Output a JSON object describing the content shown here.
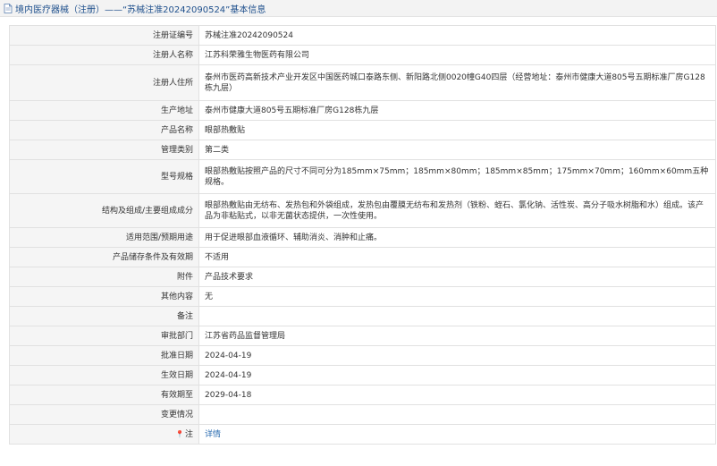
{
  "header": {
    "title": "境内医疗器械（注册）——“苏械注准20242090524”基本信息"
  },
  "rows": [
    {
      "label": "注册证编号",
      "value": "苏械注准20242090524"
    },
    {
      "label": "注册人名称",
      "value": "江苏科荣雅生物医药有限公司"
    },
    {
      "label": "注册人住所",
      "value": "泰州市医药高新技术产业开发区中国医药城口泰路东侧、新阳路北侧0020幢G40四层（经营地址：泰州市健康大道805号五期标准厂房G128栋九层）"
    },
    {
      "label": "生产地址",
      "value": "泰州市健康大道805号五期标准厂房G128栋九层"
    },
    {
      "label": "产品名称",
      "value": "眼部热敷贴"
    },
    {
      "label": "管理类别",
      "value": "第二类"
    },
    {
      "label": "型号规格",
      "value": "眼部热敷贴按照产品的尺寸不同可分为185mm×75mm；185mm×80mm；185mm×85mm；175mm×70mm；160mm×60mm五种规格。"
    },
    {
      "label": "结构及组成/主要组成成分",
      "value": "眼部热敷贴由无纺布、发热包和外袋组成，发热包由覆膜无纺布和发热剂（铁粉、蛭石、氯化钠、活性炭、高分子吸水树脂和水）组成。该产品为非粘贴式，以非无菌状态提供，一次性使用。"
    },
    {
      "label": "适用范围/预期用途",
      "value": "用于促进眼部血液循环、辅助消炎、消肿和止痛。"
    },
    {
      "label": "产品储存条件及有效期",
      "value": "不适用"
    },
    {
      "label": "附件",
      "value": "产品技术要求"
    },
    {
      "label": "其他内容",
      "value": "无"
    },
    {
      "label": "备注",
      "value": ""
    },
    {
      "label": "审批部门",
      "value": "江苏省药品监督管理局"
    },
    {
      "label": "批准日期",
      "value": "2024-04-19"
    },
    {
      "label": "生效日期",
      "value": "2024-04-19"
    },
    {
      "label": "有效期至",
      "value": "2029-04-18"
    },
    {
      "label": "变更情况",
      "value": ""
    }
  ],
  "note": {
    "icon": "pin-icon",
    "icon_glyph": "📍",
    "label": "注",
    "link": "详情"
  },
  "colors": {
    "link": "#2b6cb0",
    "title": "#1e4f8c",
    "label_bg": "#f5f5f5",
    "border": "#e1e1e1"
  }
}
